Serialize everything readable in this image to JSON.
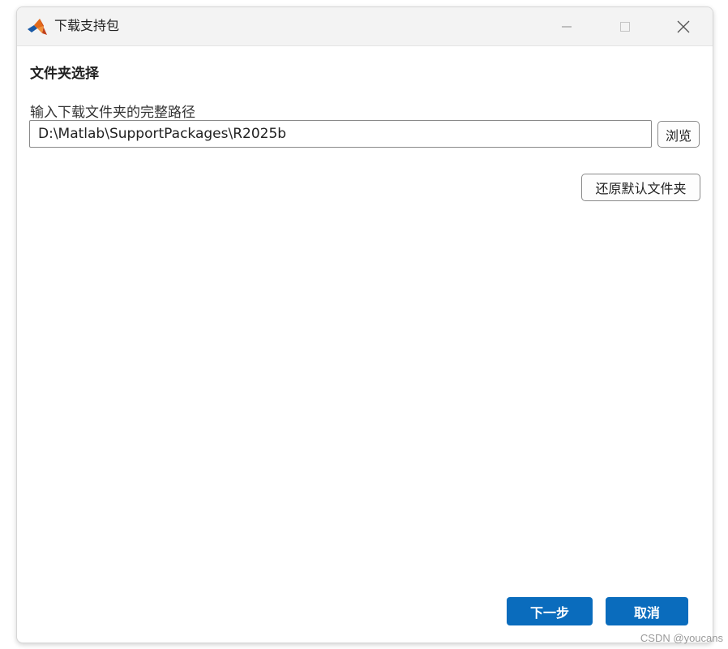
{
  "window": {
    "title": "下载支持包",
    "app_icon": "matlab-logo-icon",
    "controls": {
      "minimize_icon": "minimize-icon",
      "maximize_icon": "maximize-icon",
      "close_icon": "close-icon"
    }
  },
  "main": {
    "section_title": "文件夹选择",
    "path_label": "输入下载文件夹的完整路径",
    "path_value": "D:\\Matlab\\SupportPackages\\R2025b",
    "browse_label": "浏览",
    "restore_label": "还原默认文件夹"
  },
  "footer": {
    "next_label": "下一步",
    "cancel_label": "取消"
  },
  "watermark": "CSDN @youcans",
  "colors": {
    "primary_button": "#0a6cbd",
    "titlebar": "#f3f3f3"
  }
}
